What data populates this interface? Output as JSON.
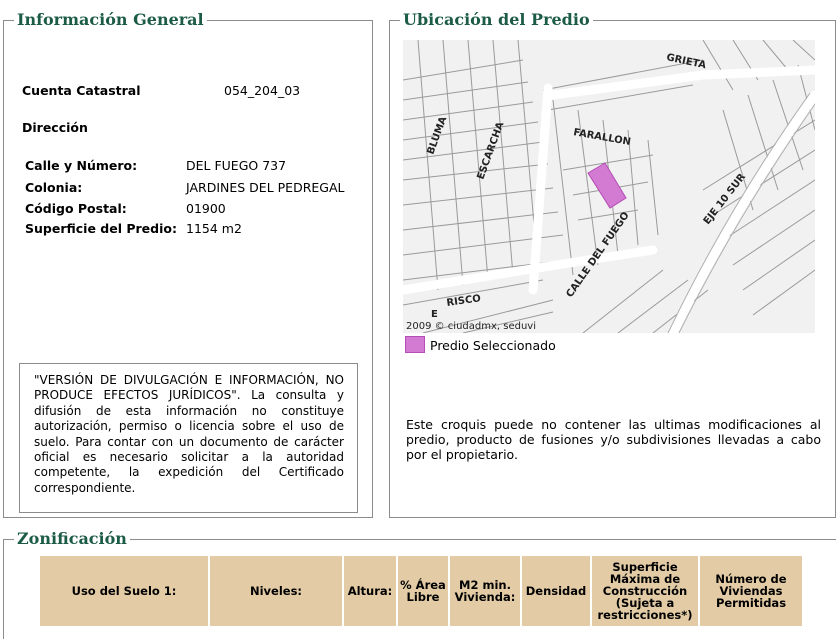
{
  "info": {
    "legend": "Información General",
    "cuenta_label": "Cuenta Catastral",
    "cuenta_value": "054_204_03",
    "direccion_label": "Dirección",
    "calle_label": "Calle y Número:",
    "calle_value": "DEL FUEGO 737",
    "colonia_label": "Colonia:",
    "colonia_value": "JARDINES DEL PEDREGAL",
    "cp_label": "Código Postal:",
    "cp_value": "01900",
    "superficie_label": "Superficie del Predio:",
    "superficie_value": "1154 m2",
    "notice": "\"VERSIÓN DE DIVULGACIÓN E INFORMACIÓN, NO PRODUCE EFECTOS JURÍDICOS\". La consulta y difusión de esta información no constituye autorización, permiso o licencia sobre el uso de suelo. Para contar con un documento de carácter oficial es necesario solicitar a la autoridad competente, la expedición del Certificado correspondiente."
  },
  "ubicacion": {
    "legend": "Ubicación del Predio",
    "map_labels": {
      "grieta": "GRIETA",
      "bluma": "BLUMA",
      "escarcha": "ESCARCHA",
      "farallon": "FARALLON",
      "eje": "EJE 10 SUR",
      "calle_fuego": "CALLE DEL FUEGO",
      "risco": "RISCO",
      "e": "E",
      "copyright": "2009 © ciudadmx, seduvi"
    },
    "legend_text": "Predio Seleccionado",
    "highlight_color": "#d37ad3",
    "disclaimer": "Este croquis puede no contener las ultimas modificaciones al predio, producto de fusiones y/o subdivisiones llevadas a cabo por el propietario."
  },
  "zonificacion": {
    "legend": "Zonificación",
    "columns": [
      "Uso del Suelo 1:",
      "Niveles:",
      "Altura:",
      "% Área Libre",
      "M2 min. Vivienda:",
      "Densidad",
      "Superficie Máxima de Construcción (Sujeta a restricciones*)",
      "Número de Viviendas Permitidas"
    ],
    "header_color": "#e2cba5"
  }
}
